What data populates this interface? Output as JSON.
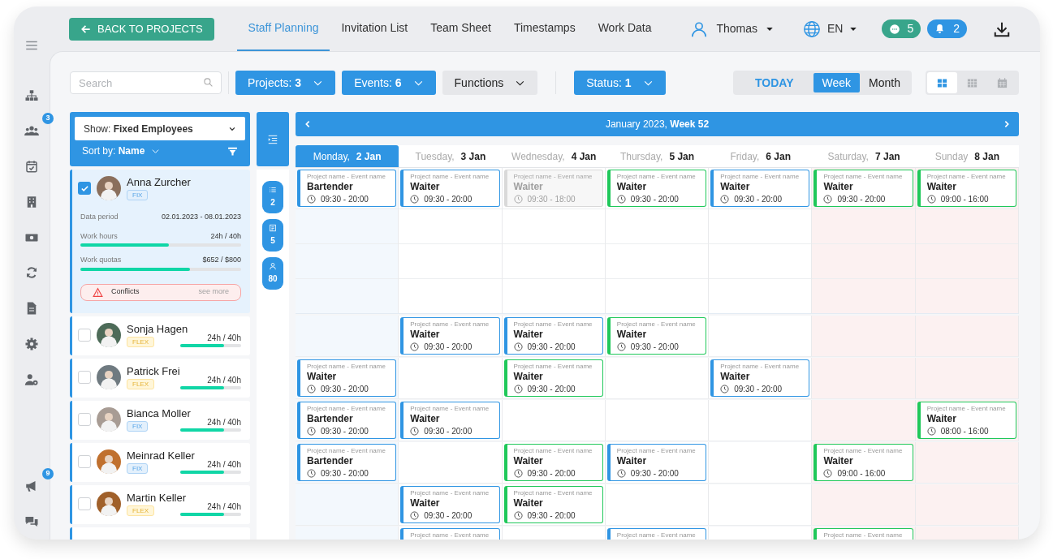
{
  "top_bar": {
    "back_button": "BACK TO PROJECTS",
    "tabs": [
      {
        "label": "Staff Planning",
        "selected": true
      },
      {
        "label": "Invitation List",
        "selected": false
      },
      {
        "label": "Team Sheet",
        "selected": false
      },
      {
        "label": "Timestamps",
        "selected": false
      },
      {
        "label": "Work Data",
        "selected": false
      }
    ],
    "user": "Thomas",
    "language": "EN",
    "messages_count": "5",
    "notifications_count": "2"
  },
  "sidebar": {
    "team_badge": "3",
    "announcements_badge": "9"
  },
  "toolbar": {
    "search": {
      "placeholder": "Search"
    },
    "filters": [
      {
        "label": "Projects: **3**",
        "active": true
      },
      {
        "label": "Events: **6**",
        "active": true
      },
      {
        "label": "Functions",
        "active": false
      }
    ],
    "status_filter": {
      "label": "Status: **1**",
      "active": true
    },
    "range": [
      {
        "label": "TODAY",
        "kind": "link",
        "selected": false
      },
      {
        "label": "Week",
        "kind": "toggle",
        "selected": true
      },
      {
        "label": "Month",
        "kind": "toggle",
        "selected": false
      }
    ],
    "views": [
      {
        "kind": "large-grid",
        "selected": true
      },
      {
        "kind": "small-grid",
        "selected": false
      },
      {
        "kind": "calendar",
        "selected": false
      }
    ]
  },
  "employee_panel": {
    "show": "Show: **Fixed Employees**",
    "sort": "Sort by: **Name**",
    "employees": [
      {
        "name": "Anna Zurcher",
        "contract": "FIX",
        "checked": true,
        "expanded": true,
        "details": {
          "period_label": "Data period",
          "period": "02.01.2023 - 08.01.2023",
          "work_hours": {
            "label": "Work hours",
            "value": "24h / 40h",
            "level": 0.55
          },
          "work_quotas": {
            "label": "Work quotas",
            "value": "$652 / $800",
            "level": 0.68
          },
          "conflicts": "Conflicts",
          "see_more": "see more"
        }
      },
      {
        "name": "Sonja Hagen",
        "contract": "FLEX",
        "checked": false,
        "expanded": false,
        "hours": "24h / 40h",
        "level": 0.72
      },
      {
        "name": "Patrick Frei",
        "contract": "FLEX",
        "checked": false,
        "expanded": false,
        "hours": "24h / 40h",
        "level": 0.72
      },
      {
        "name": "Bianca Moller",
        "contract": "FIX",
        "checked": false,
        "expanded": false,
        "hours": "24h / 40h",
        "level": 0.72
      },
      {
        "name": "Meinrad Keller",
        "contract": "FIX",
        "checked": false,
        "expanded": false,
        "hours": "24h / 40h",
        "level": 0.72
      },
      {
        "name": "Martin Keller",
        "contract": "FLEX",
        "checked": false,
        "expanded": false,
        "hours": "24h / 40h",
        "level": 0.72
      }
    ]
  },
  "summary_pills": [
    {
      "kind": "list",
      "count": "2"
    },
    {
      "kind": "document",
      "count": "5"
    },
    {
      "kind": "person",
      "count": "80"
    }
  ],
  "calendar": {
    "title": "January 2023, **Week 52**",
    "days": [
      {
        "weekday": "Monday,",
        "date": "2 Jan",
        "selected": true,
        "weekend": false
      },
      {
        "weekday": "Tuesday,",
        "date": "3 Jan",
        "selected": false,
        "weekend": false
      },
      {
        "weekday": "Wednesday,",
        "date": "4 Jan",
        "selected": false,
        "weekend": false
      },
      {
        "weekday": "Thursday,",
        "date": "5 Jan",
        "selected": false,
        "weekend": false
      },
      {
        "weekday": "Friday,",
        "date": "6 Jan",
        "selected": false,
        "weekend": false
      },
      {
        "weekday": "Saturday,",
        "date": "7 Jan",
        "selected": false,
        "weekend": true
      },
      {
        "weekday": "Sunday",
        "date": "8 Jan",
        "selected": false,
        "weekend": true
      }
    ],
    "rows": [
      {
        "cells": [
          {
            "kind": "shift",
            "subtitle": "Project name - Event name",
            "role": "Bartender",
            "time": "09:30 - 20:00",
            "color": "#2f95e3",
            "disabled": false
          },
          {
            "kind": "shift",
            "subtitle": "Project name - Event name",
            "role": "Waiter",
            "time": "09:30 - 20:00",
            "color": "#2f95e3",
            "disabled": false
          },
          {
            "kind": "shift",
            "subtitle": "Project name - Event name",
            "role": "Waiter",
            "time": "09:30 - 18:00",
            "color": "#d9d9d9",
            "disabled": true
          },
          {
            "kind": "shift",
            "subtitle": "Project name - Event name",
            "role": "Waiter",
            "time": "09:30 - 20:00",
            "color": "#1fc85a",
            "disabled": false
          },
          {
            "kind": "shift",
            "subtitle": "Project name - Event name",
            "role": "Waiter",
            "time": "09:30 - 20:00",
            "color": "#2f95e3",
            "disabled": false
          },
          {
            "kind": "shift",
            "subtitle": "Project name - Event name",
            "role": "Waiter",
            "time": "09:30 - 20:00",
            "color": "#1fc85a",
            "disabled": false
          },
          {
            "kind": "shift",
            "subtitle": "Project name - Event name",
            "role": "Waiter",
            "time": "09:00 - 16:00",
            "color": "#1fc85a",
            "disabled": false
          }
        ]
      },
      {
        "cells": [
          {
            "kind": "empty"
          },
          {
            "kind": "shift",
            "subtitle": "Project name - Event name",
            "role": "Waiter",
            "time": "09:30 - 20:00",
            "color": "#2f95e3",
            "disabled": false
          },
          {
            "kind": "shift",
            "subtitle": "Project name - Event name",
            "role": "Waiter",
            "time": "09:30 - 20:00",
            "color": "#2f95e3",
            "disabled": false
          },
          {
            "kind": "shift",
            "subtitle": "Project name - Event name",
            "role": "Waiter",
            "time": "09:30 - 20:00",
            "color": "#1fc85a",
            "disabled": false
          },
          {
            "kind": "empty"
          },
          {
            "kind": "empty"
          },
          {
            "kind": "empty"
          }
        ]
      },
      {
        "cells": [
          {
            "kind": "shift",
            "subtitle": "Project name - Event name",
            "role": "Waiter",
            "time": "09:30 - 20:00",
            "color": "#2f95e3",
            "disabled": false
          },
          {
            "kind": "empty"
          },
          {
            "kind": "shift",
            "subtitle": "Project name - Event name",
            "role": "Waiter",
            "time": "09:30 - 20:00",
            "color": "#1fc85a",
            "disabled": false
          },
          {
            "kind": "empty"
          },
          {
            "kind": "shift",
            "subtitle": "Project name - Event name",
            "role": "Waiter",
            "time": "09:30 - 20:00",
            "color": "#2f95e3",
            "disabled": false
          },
          {
            "kind": "empty"
          },
          {
            "kind": "empty"
          }
        ]
      },
      {
        "cells": [
          {
            "kind": "shift",
            "subtitle": "Project name - Event name",
            "role": "Bartender",
            "time": "09:30 - 20:00",
            "color": "#2f95e3",
            "disabled": false
          },
          {
            "kind": "shift",
            "subtitle": "Project name - Event name",
            "role": "Waiter",
            "time": "09:30 - 20:00",
            "color": "#2f95e3",
            "disabled": false
          },
          {
            "kind": "empty"
          },
          {
            "kind": "empty"
          },
          {
            "kind": "empty"
          },
          {
            "kind": "empty"
          },
          {
            "kind": "shift",
            "subtitle": "Project name - Event name",
            "role": "Waiter",
            "time": "08:00 - 16:00",
            "color": "#1fc85a",
            "disabled": false
          }
        ]
      },
      {
        "cells": [
          {
            "kind": "shift",
            "subtitle": "Project name - Event name",
            "role": "Bartender",
            "time": "09:30 - 20:00",
            "color": "#2f95e3",
            "disabled": false
          },
          {
            "kind": "empty"
          },
          {
            "kind": "shift",
            "subtitle": "Project name - Event name",
            "role": "Waiter",
            "time": "09:30 - 20:00",
            "color": "#1fc85a",
            "disabled": false
          },
          {
            "kind": "shift",
            "subtitle": "Project name - Event name",
            "role": "Waiter",
            "time": "09:30 - 20:00",
            "color": "#2f95e3",
            "disabled": false
          },
          {
            "kind": "empty"
          },
          {
            "kind": "shift",
            "subtitle": "Project name - Event name",
            "role": "Waiter",
            "time": "09:00 - 16:00",
            "color": "#1fc85a",
            "disabled": false
          },
          {
            "kind": "empty"
          }
        ]
      },
      {
        "cells": [
          {
            "kind": "empty"
          },
          {
            "kind": "shift",
            "subtitle": "Project name - Event name",
            "role": "Waiter",
            "time": "09:30 - 20:00",
            "color": "#2f95e3",
            "disabled": false
          },
          {
            "kind": "shift",
            "subtitle": "Project name - Event name",
            "role": "Waiter",
            "time": "09:30 - 20:00",
            "color": "#1fc85a",
            "disabled": false
          },
          {
            "kind": "empty"
          },
          {
            "kind": "empty"
          },
          {
            "kind": "empty"
          },
          {
            "kind": "empty"
          }
        ]
      },
      {
        "cells": [
          {
            "kind": "empty"
          },
          {
            "kind": "shift",
            "subtitle": "Project name - Event name",
            "color": "#2f95e3"
          },
          {
            "kind": "empty"
          },
          {
            "kind": "shift",
            "subtitle": "Project name - Event name",
            "color": "#2f95e3"
          },
          {
            "kind": "empty"
          },
          {
            "kind": "shift",
            "subtitle": "Project name - Event name",
            "color": "#1fc85a"
          },
          {
            "kind": "empty"
          }
        ]
      }
    ]
  }
}
